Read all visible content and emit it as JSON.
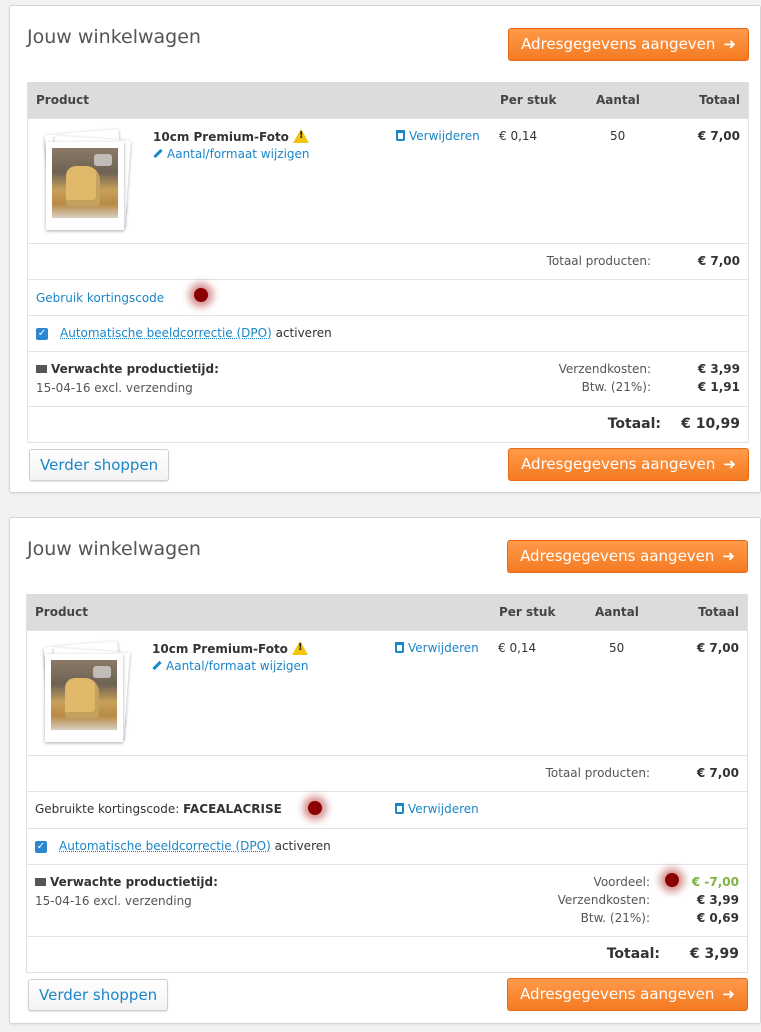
{
  "common": {
    "title": "Jouw winkelwagen",
    "checkout_label": "Adresgegevens aangeven",
    "arrow": "➜",
    "continue_label": "Verder shoppen",
    "col_product": "Product",
    "col_per_piece": "Per stuk",
    "col_quantity": "Aantal",
    "col_total": "Totaal",
    "product_name": "10cm Premium-Foto",
    "edit_label": "Aantal/formaat wijzigen",
    "remove_label": "Verwijderen",
    "unit_price": "€ 0,14",
    "quantity": "50",
    "line_total": "€ 7,00",
    "products_total_label": "Totaal producten:",
    "products_total": "€ 7,00",
    "dpo_link": "Automatische beeldcorrectie (DPO)",
    "dpo_suffix": "activeren",
    "production_label": "Verwachte productietijd:",
    "production_date": "15-04-16 excl. verzending",
    "shipping_label": "Verzendkosten:",
    "vat_label": "Btw. (21%):",
    "grand_total_label": "Totaal:",
    "checkmark": "✓"
  },
  "cart1": {
    "coupon_link": "Gebruik kortingscode",
    "shipping": "€ 3,99",
    "vat": "€ 1,91",
    "grand_total": "€ 10,99"
  },
  "cart2": {
    "coupon_used_label": "Gebruikte kortingscode:",
    "coupon_code": "FACEALACRISE",
    "discount_label": "Voordeel:",
    "discount": "€ -7,00",
    "shipping": "€ 3,99",
    "vat": "€ 0,69",
    "grand_total": "€ 3,99"
  }
}
